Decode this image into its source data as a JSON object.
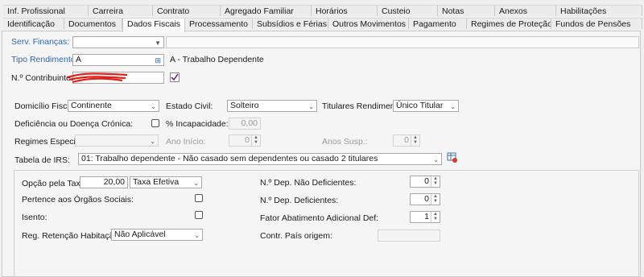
{
  "tabs_top": [
    "Inf. Profissional",
    "Carreira",
    "Contrato",
    "Agregado Familiar",
    "Horários",
    "Custeio",
    "Notas",
    "Anexos",
    "Habilitações"
  ],
  "tabs_bottom": [
    "Identificação",
    "Documentos",
    "Dados Fiscais",
    "Processamento",
    "Subsídios e Férias",
    "Outros Movimentos",
    "Pagamento",
    "Regimes de Proteção",
    "Fundos de Pensões"
  ],
  "active_tab": "Dados Fiscais",
  "form": {
    "serv_financas_label": "Serv. Finanças:",
    "serv_financas_value": "",
    "tipo_rendimento_label": "Tipo Rendimento:",
    "tipo_rendimento_value": "A",
    "tipo_rendimento_desc": "A - Trabalho Dependente",
    "contribuinte_label": "N.º Contribuinte:",
    "contribuinte_value": "",
    "domicilio_label": "Domicílio Fiscal:",
    "domicilio_value": "Continente",
    "estado_civil_label": "Estado Civil:",
    "estado_civil_value": "Solteiro",
    "titulares_label": "Titulares Rendimento:",
    "titulares_value": "Único Titular",
    "deficiencia_label": "Deficiência ou Doença Crónica:",
    "incapacidade_label": "% Incapacidade:",
    "incapacidade_value": "0,00",
    "regimes_label": "Regimes Especiais:",
    "regimes_value": "",
    "ano_inicio_label": "Ano Início:",
    "ano_inicio_value": "0",
    "anos_susp_label": "Anos Susp.:",
    "anos_susp_value": "0",
    "tabela_irs_label": "Tabela de IRS:",
    "tabela_irs_value": "01: Trabalho dependente - Não casado sem dependentes ou casado 2 titulares"
  },
  "group": {
    "opcao_taxa_label": "Opção pela Taxa:",
    "opcao_taxa_value": "20,00",
    "taxa_tipo_value": "Taxa Efetiva",
    "orgaos_sociais_label": "Pertence aos Órgãos Sociais:",
    "isento_label": "Isento:",
    "reg_retencao_label": "Reg. Retenção Habitação:",
    "reg_retencao_value": "Não Aplicável",
    "dep_nao_def_label": "N.º Dep. Não Deficientes:",
    "dep_nao_def_value": "0",
    "dep_def_label": "N.º Dep. Deficientes:",
    "dep_def_value": "0",
    "fator_label": "Fator Abatimento Adicional Def:",
    "fator_value": "1",
    "contr_pais_label": "Contr. País origem:",
    "contr_pais_value": ""
  },
  "colors": {
    "accent_label": "#2b66b8",
    "pencil": "#7a2a8a",
    "redaction": "#e0201a"
  }
}
